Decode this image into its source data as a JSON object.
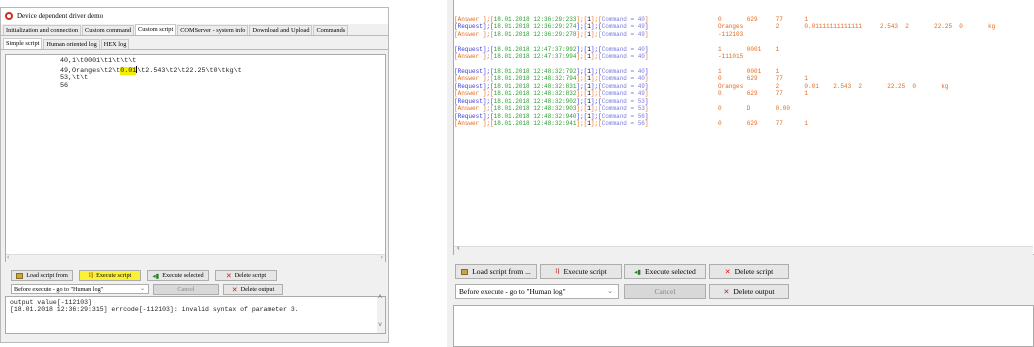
{
  "left_window": {
    "title": "Device dependent driver demo",
    "tabs": [
      "Initialization and connection",
      "Custom command",
      "Custom script",
      "COMServer - system info",
      "Download and Upload",
      "Commands"
    ],
    "subtabs": [
      "Simple script",
      "Human oriented log",
      "HEX log"
    ],
    "script_lines": [
      {
        "pre": "40,1\\t0001\\t1\\t\\t\\t",
        "mark": "",
        "post": ""
      },
      {
        "pre": "49,Oranges\\t2\\t",
        "mark": "0.01",
        "post": "\\t2.543\\t2\\t22.25\\t0\\tkg\\t"
      },
      {
        "pre": "53,\\t\\t",
        "mark": "",
        "post": ""
      },
      {
        "pre": "56",
        "mark": "",
        "post": ""
      }
    ],
    "buttons": {
      "load": "Load script from",
      "execute": "Execute script",
      "execute_selected": "Execute selected",
      "delete_script": "Delete script",
      "cancel": "Cancel",
      "delete_output": "Delete output"
    },
    "before_execute": "Before execute - go to \"Human log\"",
    "output_lines": [
      "output value[-112103]",
      "[18.01.2018 12:36:29:315] errcode[-112103]: invalid syntax of parameter 3."
    ]
  },
  "right_window": {
    "log": [
      {
        "dir": "Answer ",
        "ts": "18.01.2018 12:36:29:233",
        "idx": "1",
        "cmd": "Command = 40",
        "vals": "0       629     77      1"
      },
      {
        "dir": "Request",
        "ts": "18.01.2018 12:36:29:274",
        "idx": "1",
        "cmd": "Command = 49",
        "vals": "Oranges         2       0.01111111111111     2.543  2       22.25  0       kg"
      },
      {
        "dir": "Answer ",
        "ts": "18.01.2018 12:36:29:278",
        "idx": "1",
        "cmd": "Command = 49",
        "vals": "-112103"
      },
      {
        "dir": "",
        "ts": "",
        "idx": "",
        "cmd": "",
        "vals": ""
      },
      {
        "dir": "Request",
        "ts": "18.01.2018 12:47:37:992",
        "idx": "1",
        "cmd": "Command = 40",
        "vals": "1       0001    1"
      },
      {
        "dir": "Answer ",
        "ts": "18.01.2018 12:47:37:994",
        "idx": "1",
        "cmd": "Command = 40",
        "vals": "-111015"
      },
      {
        "dir": "",
        "ts": "",
        "idx": "",
        "cmd": "",
        "vals": ""
      },
      {
        "dir": "Request",
        "ts": "18.01.2018 12:48:32:792",
        "idx": "1",
        "cmd": "Command = 40",
        "vals": "1       0001    1"
      },
      {
        "dir": "Answer ",
        "ts": "18.01.2018 12:48:32:794",
        "idx": "1",
        "cmd": "Command = 40",
        "vals": "0       629     77      1"
      },
      {
        "dir": "Request",
        "ts": "18.01.2018 12:48:32:831",
        "idx": "1",
        "cmd": "Command = 49",
        "vals": "Oranges         2       0.01    2.543  2       22.25  0       kg"
      },
      {
        "dir": "Answer ",
        "ts": "18.01.2018 12:48:32:832",
        "idx": "1",
        "cmd": "Command = 49",
        "vals": "0       629     77      1"
      },
      {
        "dir": "Request",
        "ts": "18.01.2018 12:48:32:902",
        "idx": "1",
        "cmd": "Command = 53",
        "vals": ""
      },
      {
        "dir": "Answer ",
        "ts": "18.01.2018 12:48:32:903",
        "idx": "1",
        "cmd": "Command = 53",
        "vals": "0       D       0.00"
      },
      {
        "dir": "Request",
        "ts": "18.01.2018 12:48:32:940",
        "idx": "1",
        "cmd": "Command = 56",
        "vals": ""
      },
      {
        "dir": "Answer ",
        "ts": "18.01.2018 12:48:32:941",
        "idx": "1",
        "cmd": "Command = 56",
        "vals": "0       629     77      1"
      }
    ],
    "buttons": {
      "load": "Load script from ...",
      "execute": "Execute script",
      "execute_selected": "Execute selected",
      "delete_script": "Delete script",
      "cancel": "Cancel",
      "delete_output": "Delete output"
    },
    "before_execute": "Before execute - go to \"Human log\""
  }
}
